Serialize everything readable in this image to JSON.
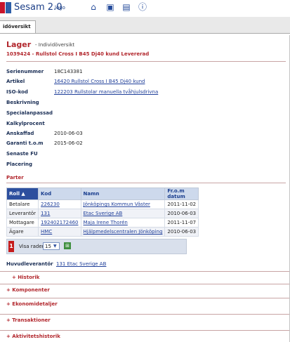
{
  "app": {
    "title": "Sesam 2.0",
    "logo_text": "logo"
  },
  "toolbar": {
    "icons": [
      "home-icon",
      "card-icon",
      "monitor-icon",
      "help-icon"
    ]
  },
  "tabs": [
    {
      "label": "idöversikt"
    }
  ],
  "header": {
    "section": "Lager",
    "subtitle": "- Individöversikt",
    "item": "1039424 - Rullstol Cross I B45 Dj40 kund  Levererad"
  },
  "fields": [
    {
      "label": "Serienummer",
      "value": "18C143381"
    },
    {
      "label": "Artikel",
      "value": "16420 Rullstol Cross I B45 Dj40 kund"
    },
    {
      "label": "ISO-kod",
      "value": "122203 Rullstolar manuella tvåhjulsdrivna"
    },
    {
      "label": "Beskrivning",
      "value": ""
    },
    {
      "label": "Specialanpassad",
      "value": ""
    },
    {
      "label": "Kalkylprocent",
      "value": ""
    },
    {
      "label": "Anskaffad",
      "value": "2010-06-03"
    },
    {
      "label": "Garanti t.o.m",
      "value": "2015-06-02"
    },
    {
      "label": "Senaste FU",
      "value": ""
    },
    {
      "label": "Placering",
      "value": ""
    }
  ],
  "parter": {
    "title": "Parter",
    "columns": [
      "Roll ▲",
      "Kod",
      "Namn",
      "Fr.o.m datum"
    ],
    "rows": [
      {
        "roll": "Betalare",
        "kod": "226230",
        "namn": "Jönköpings Kommun Väster",
        "datum": "2011-11-02"
      },
      {
        "roll": "Leverantör",
        "kod": "131",
        "namn": "Etac Sverige AB",
        "datum": "2010-06-03"
      },
      {
        "roll": "Mottagare",
        "kod": "192402172460",
        "namn": "Maja Irene Thorén",
        "datum": "2011-11-07"
      },
      {
        "roll": "Ägare",
        "kod": "HMC",
        "namn": "Hjälpmedelscentralen Jönköping",
        "datum": "2010-06-03"
      }
    ],
    "page": "1",
    "visa_rader_label": "Visa rader",
    "rows_per_page": "15"
  },
  "huvudleverantor": {
    "label": "Huvudleverantör",
    "value": "131 Etac Sverige AB"
  },
  "sections": [
    "+ Historik",
    "+ Komponenter",
    "+ Ekonomidetaljer",
    "+ Transaktioner",
    "+ Aktivitetshistorik"
  ]
}
